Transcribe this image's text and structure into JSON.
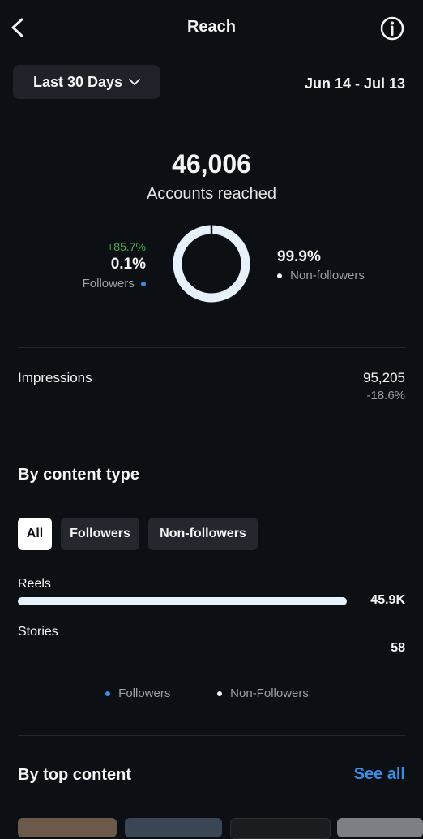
{
  "header": {
    "title": "Reach",
    "back_icon": "chevron-left-icon",
    "info_icon": "info-icon"
  },
  "filter": {
    "range_label": "Last 30 Days",
    "dropdown_icon": "chevron-down-icon",
    "date_range": "Jun 14 - Jul 13"
  },
  "summary": {
    "accounts_reached_value": "46,006",
    "accounts_reached_label": "Accounts reached",
    "followers": {
      "change": "+85.7%",
      "percent": "0.1%",
      "label": "Followers",
      "share": 0.001,
      "color": "#3a8ee6"
    },
    "non_followers": {
      "percent": "99.9%",
      "label": "Non-followers",
      "share": 0.999,
      "color": "#e6f1fa"
    }
  },
  "impressions": {
    "label": "Impressions",
    "value": "95,205",
    "change": "-18.6%"
  },
  "content_type": {
    "title": "By content type",
    "filters": [
      {
        "label": "All",
        "active": true
      },
      {
        "label": "Followers",
        "active": false
      },
      {
        "label": "Non-followers",
        "active": false
      }
    ],
    "rows": [
      {
        "label": "Reels",
        "value": "45.9K",
        "fraction": 1.0
      },
      {
        "label": "Stories",
        "value": "58",
        "fraction": 0.0013
      }
    ],
    "legend": [
      {
        "label": "Followers",
        "color": "#3a8ee6"
      },
      {
        "label": "Non-Followers",
        "color": "#f5f5f5"
      }
    ]
  },
  "top_content": {
    "title": "By top content",
    "see_all": "See all"
  },
  "colors": {
    "background": "#0c0f14",
    "accent_blue": "#3a8ee6",
    "positive_green": "#4cb051"
  }
}
